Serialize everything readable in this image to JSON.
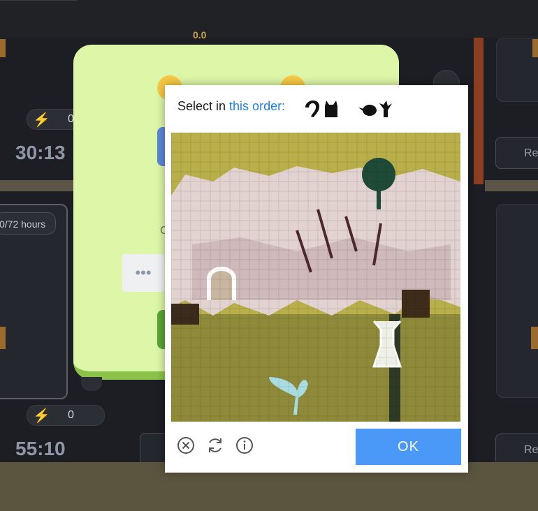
{
  "background": {
    "timer_top": "30:13",
    "timer_bottom": "55:10",
    "energy_top": "0",
    "energy_bottom": "0",
    "hours_badge": "0/72 hours",
    "right_button_top": "Re",
    "right_button_bottom": "Re",
    "top_fragment": "0.0"
  },
  "modal": {
    "partial_letter": "C",
    "dots": "•••"
  },
  "captcha": {
    "prompt_prefix": "Select in ",
    "prompt_link": "this order:",
    "ok_label": "OK",
    "icons": [
      "close-circle-icon",
      "refresh-icon",
      "info-icon"
    ],
    "colors": {
      "ok": "#4a98f7",
      "link": "#1f7fe0"
    }
  }
}
